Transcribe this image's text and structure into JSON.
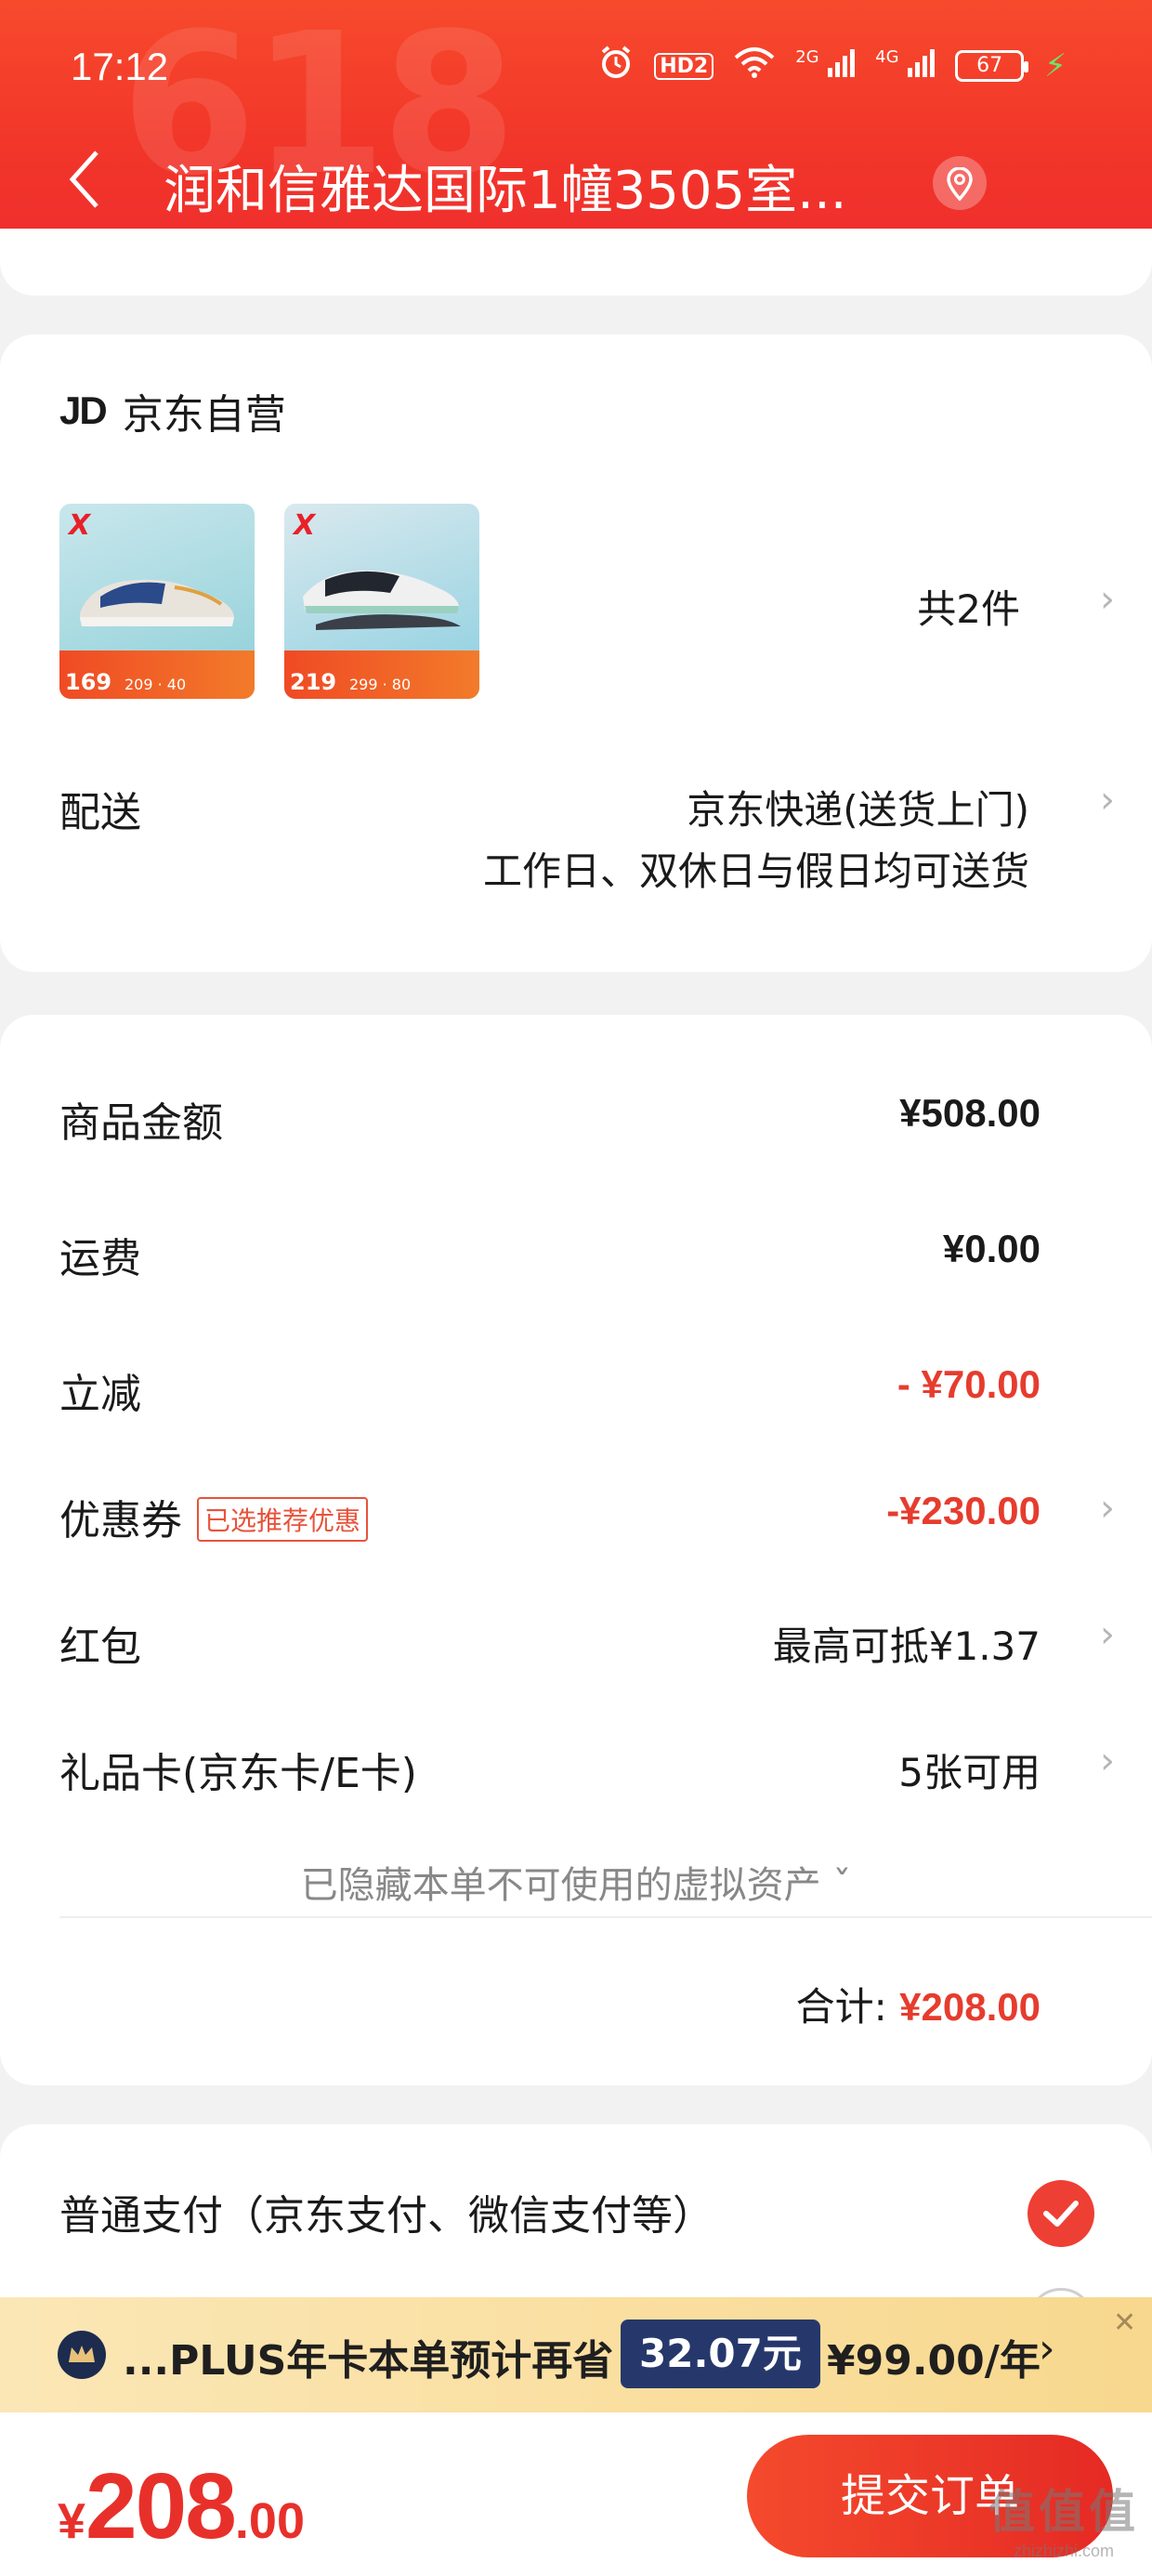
{
  "status_bar": {
    "time": "17:12",
    "hd_label": "HD2",
    "net_2g": "2G",
    "net_4g": "4G",
    "battery": "67"
  },
  "header": {
    "deco_text": "618",
    "address": "润和信雅达国际1幢3505室..."
  },
  "store": {
    "logo": "JD",
    "name": "京东自营",
    "products": [
      {
        "brand": "X特步",
        "price": "169",
        "old": "209 · 40"
      },
      {
        "brand": "X特步",
        "price": "219",
        "old": "299 · 80"
      }
    ],
    "count_text": "共2件",
    "delivery": {
      "label": "配送",
      "line1": "京东快递(送货上门)",
      "line2": "工作日、双休日与假日均可送货"
    }
  },
  "prices": {
    "goods": {
      "label": "商品金额",
      "value": "¥508.00"
    },
    "shipping": {
      "label": "运费",
      "value": "¥0.00"
    },
    "discount": {
      "label": "立减",
      "value": "- ¥70.00"
    },
    "coupon": {
      "label": "优惠券",
      "tag": "已选推荐优惠",
      "value": "-¥230.00"
    },
    "redpacket": {
      "label": "红包",
      "value": "最高可抵¥1.37"
    },
    "giftcard": {
      "label": "礼品卡(京东卡/E卡)",
      "value": "5张可用"
    },
    "hidden_note": "已隐藏本单不可使用的虚拟资产 ˇ",
    "total_label": "合计:",
    "total_value": "¥208.00"
  },
  "payment": {
    "label": "普通支付（京东支付、微信支付等）"
  },
  "plus_banner": {
    "text": "...PLUS年卡本单预计再省",
    "save": "32.07元",
    "price": "¥99.00/年",
    "close": "✕"
  },
  "bottom": {
    "currency": "¥",
    "integer": "208",
    "decimal": ".00",
    "submit": "提交订单"
  },
  "watermark": {
    "line1": "值值值",
    "line2": "zhizhizhi.com"
  },
  "colors": {
    "accent_red": "#e63c2e",
    "header_red": "#f2362a",
    "plus_navy": "#26386b",
    "plus_gold": "#f8d88e"
  }
}
